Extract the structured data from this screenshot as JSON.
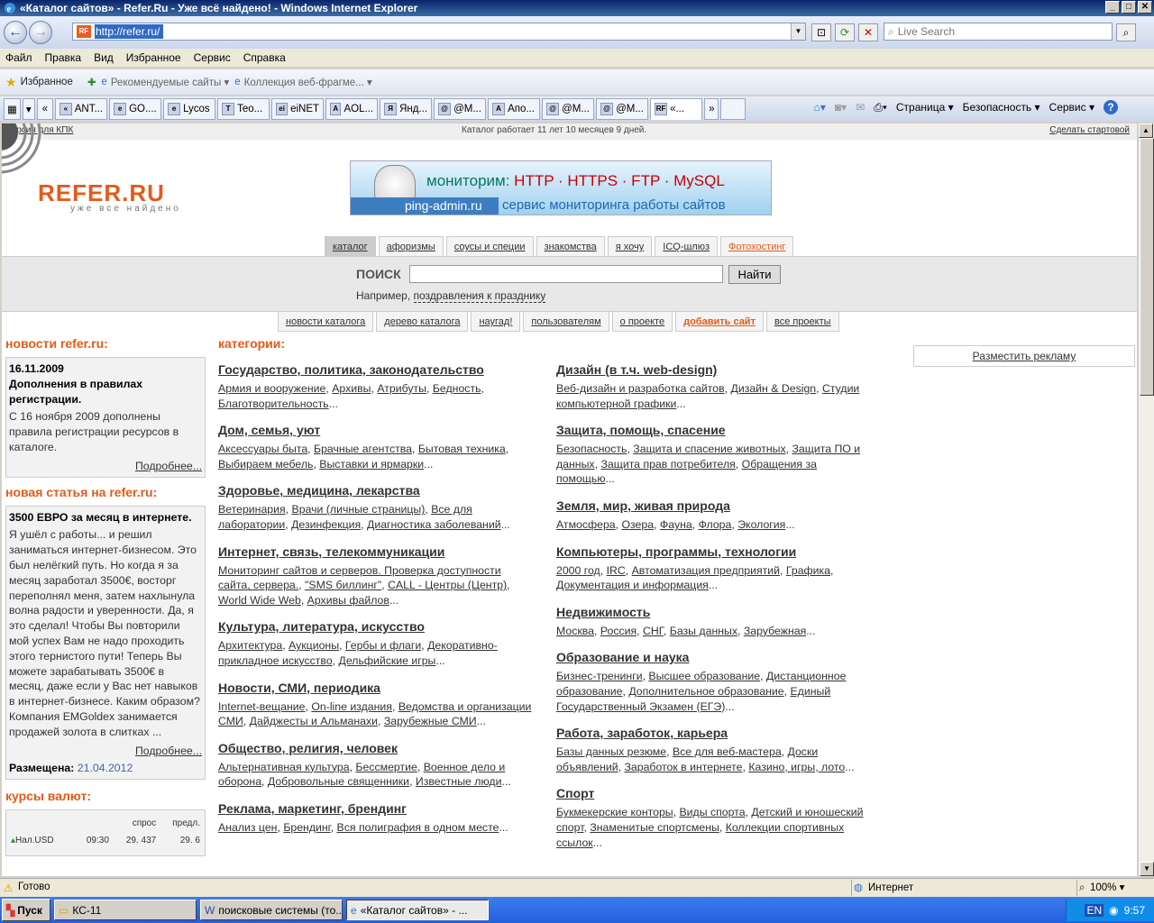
{
  "window": {
    "title": "«Каталог сайтов» - Refer.Ru - Уже всё найдено! - Windows Internet Explorer",
    "min": "_",
    "max": "□",
    "close": "✕"
  },
  "address": {
    "url": "http://refer.ru/",
    "search_placeholder": "Live Search"
  },
  "menu": [
    "Файл",
    "Правка",
    "Вид",
    "Избранное",
    "Сервис",
    "Справка"
  ],
  "favorites": {
    "label": "Избранное",
    "items": [
      "Рекомендуемые сайты ▾",
      "Коллекция веб-фрагме... ▾"
    ]
  },
  "tabs": [
    {
      "icon": "«",
      "label": "ANT..."
    },
    {
      "icon": "e",
      "label": "GO...."
    },
    {
      "icon": "e",
      "label": "Lycos"
    },
    {
      "icon": "T",
      "label": "Teo..."
    },
    {
      "icon": "ei",
      "label": "eiNET"
    },
    {
      "icon": "A",
      "label": "AOL..."
    },
    {
      "icon": "Я",
      "label": "Янд..."
    },
    {
      "icon": "@",
      "label": "@M..."
    },
    {
      "icon": "A",
      "label": "Апо..."
    },
    {
      "icon": "@",
      "label": "@M..."
    },
    {
      "icon": "@",
      "label": "@M..."
    },
    {
      "icon": "RF",
      "label": "«..."
    }
  ],
  "commands": {
    "page": "Страница ▾",
    "security": "Безопасность ▾",
    "tools": "Сервис ▾",
    "help": "?"
  },
  "site": {
    "topleft": "Версия для КПК",
    "topcenter": "Каталог работает 11 лет 10 месяцев 9 дней.",
    "topright": "Сделать стартовой",
    "logo": "REFER.RU",
    "logo_sub": "уже все найдено",
    "banner": {
      "t1a": "мониторим: ",
      "t1b": "HTTP · HTTPS · FTP · MySQL",
      "domain": "ping-admin.ru",
      "t2": "сервис мониторинга работы сайтов"
    },
    "menu1": [
      "каталог",
      "афоризмы",
      "соусы и специи",
      "знакомства",
      "я хочу",
      "ICQ-шлюз",
      "Фотохостинг"
    ],
    "search": {
      "label": "ПОИСК",
      "button": "Найти",
      "example_prefix": "Например,",
      "example_link": "поздравления к празднику"
    },
    "menu2": [
      "новости каталога",
      "дерево каталога",
      "наугад!",
      "пользователям",
      "о проекте",
      "добавить сайт",
      "все проекты"
    ],
    "news": {
      "header": "новости refer.ru:",
      "date": "16.11.2009",
      "title": "Дополнения в правилах регистрации.",
      "body": "С 16 ноября 2009 дополнены правила регистрации ресурсов в каталоге.",
      "more": "Подробнее..."
    },
    "article": {
      "header": "новая статья на refer.ru:",
      "title": "3500 ЕВРО за месяц в интернете.",
      "body": "Я ушёл с работы... и решил заниматься интернет-бизнесом. Это был нелёгкий путь. Но когда я за месяц заработал 3500€, восторг переполнял меня, затем нахлынула волна радости и уверенности. Да, я это сделал! Чтобы Вы повторили мой успех Вам не надо проходить этого тернистого пути! Теперь Вы можете зарабатывать 3500€ в месяц, даже если у Вас нет навыков в интернет-бизнесе. Каким образом? Компания EMGoldex занимается продажей золота в слитках ...",
      "more": "Подробнее...",
      "placed_label": "Размещена:",
      "placed_date": "21.04.2012"
    },
    "rates": {
      "header": "курсы валют:",
      "cols": [
        "спрос",
        "предл."
      ],
      "rows": [
        {
          "name": "Нал.USD",
          "time": "09:30",
          "bid": "29. 437",
          "ask": "29. 6"
        }
      ]
    },
    "categories_header": "категории:",
    "categories_left": [
      {
        "title": "Государство, политика, законодательство",
        "links": [
          "Армия и вооружение",
          "Архивы",
          "Атрибуты",
          "Бедность",
          "Благотворительность"
        ]
      },
      {
        "title": "Дом, семья, уют",
        "links": [
          "Аксессуары быта",
          "Брачные агентства",
          "Бытовая техника",
          "Выбираем мебель",
          "Выставки и ярмарки"
        ]
      },
      {
        "title": "Здоровье, медицина, лекарства",
        "links": [
          "Ветеринария",
          "Врачи (личные страницы)",
          "Все для лаборатории",
          "Дезинфекция",
          "Диагностика заболеваний"
        ]
      },
      {
        "title": "Интернет, связь, телекоммуникации",
        "links": [
          "Мониторинг сайтов и серверов. Проверка доступности сайта, сервера.",
          "\"SMS биллинг\"",
          "CALL - Центры (Центр)",
          "World Wide Web",
          "Архивы файлов"
        ]
      },
      {
        "title": "Культура, литература, искусство",
        "links": [
          "Архитектура",
          "Аукционы",
          "Гербы и флаги",
          "Декоративно-прикладное искусство",
          "Дельфийские игры"
        ]
      },
      {
        "title": "Новости, СМИ, периодика",
        "links": [
          "Internet-вещание",
          "On-line издания",
          "Ведомства и организации СМИ",
          "Дайджесты и Альманахи",
          "Зарубежные СМИ"
        ]
      },
      {
        "title": "Общество, религия, человек",
        "links": [
          "Альтернативная культура",
          "Бессмертие",
          "Военное дело и оборона",
          "Добровольные священники",
          "Известные люди"
        ]
      },
      {
        "title": "Реклама, маркетинг, брендинг",
        "links": [
          "Анализ цен",
          "Брендинг",
          "Вся полиграфия в одном месте"
        ]
      }
    ],
    "categories_right": [
      {
        "title": "Дизайн (в т.ч. web-design)",
        "links": [
          "Веб-дизайн и разработка сайтов",
          "Дизайн & Design",
          "Студии компьютерной графики"
        ]
      },
      {
        "title": "Защита, помощь, спасение",
        "links": [
          "Безопасность",
          "Защита и спасение животных",
          "Защита ПО и данных",
          "Защита прав потребителя",
          "Обращения за помощью"
        ]
      },
      {
        "title": "Земля, мир, живая природа",
        "links": [
          "Атмосфера",
          "Озера",
          "Фауна",
          "Флора",
          "Экология"
        ]
      },
      {
        "title": "Компьютеры, программы, технологии",
        "links": [
          "2000 год",
          "IRC",
          "Автоматизация предприятий",
          "Графика",
          "Документация и информация"
        ]
      },
      {
        "title": "Недвижимость",
        "links": [
          "Москва",
          "Россия",
          "СНГ",
          "Базы данных",
          "Зарубежная"
        ]
      },
      {
        "title": "Образование и наука",
        "links": [
          "Бизнес-тренинги",
          "Высшее образование",
          "Дистанционное образование",
          "Дополнительное образование",
          "Единый Государственный Экзамен (ЕГЭ)"
        ]
      },
      {
        "title": "Работа, заработок, карьера",
        "links": [
          "Базы данных резюме",
          "Все для веб-мастера",
          "Доски объявлений",
          "Заработок в интернете",
          "Казино, игры, лото"
        ]
      },
      {
        "title": "Спорт",
        "links": [
          "Букмекерские конторы",
          "Виды спорта",
          "Детский и юношеский спорт",
          "Знаменитые спортсмены",
          "Коллекции спортивных ссылок"
        ]
      }
    ],
    "ad": "Разместить рекламу"
  },
  "status": {
    "text": "Готово",
    "zone": "Интернет",
    "zoom": "100%"
  },
  "taskbar": {
    "start": "Пуск",
    "items": [
      "КС-11",
      "поисковые системы (то...",
      "«Каталог сайтов» - ..."
    ],
    "lang": "EN",
    "clock": "9:57"
  },
  "colors": {
    "brand": "#e35b1b",
    "link": "#333333"
  }
}
